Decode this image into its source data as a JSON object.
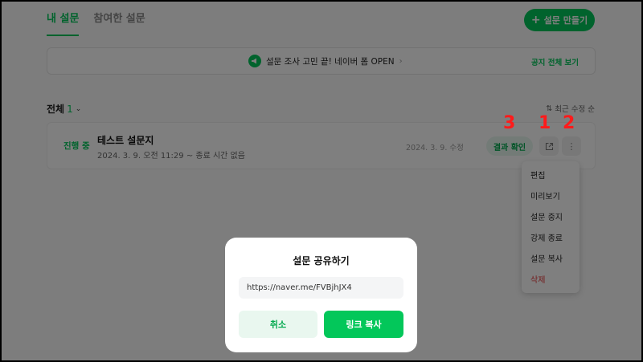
{
  "tabs": [
    {
      "label": "내 설문",
      "active": true
    },
    {
      "label": "참여한 설문",
      "active": false
    }
  ],
  "create_button": {
    "label": "설문 만들기",
    "icon": "plus-icon"
  },
  "notice": {
    "text": "설문 조사 고민 끝! 네이버 폼 OPEN",
    "view_all": "공지 전체 보기",
    "icon": "megaphone-icon"
  },
  "list": {
    "label": "전체",
    "count": "1",
    "sort_label": "최근 수정 순"
  },
  "survey": {
    "status": "진행 중",
    "title": "테스트 설문지",
    "date": "2024. 3. 9. 오전 11:29 ~ 종료 시간 없음",
    "modified": "2024. 3. 9. 수정",
    "result_button": "결과 확인"
  },
  "annotations": [
    "3",
    "1",
    "2"
  ],
  "menu": {
    "items": [
      "편집",
      "미리보기",
      "설문 중지",
      "강제 종료",
      "설문 복사",
      "삭제"
    ]
  },
  "modal": {
    "title": "설문 공유하기",
    "link": "https://naver.me/FVBjhJX4",
    "cancel": "취소",
    "copy": "링크 복사"
  },
  "colors": {
    "accent": "#03c75a",
    "danger": "#e5383b",
    "annotation": "#ff1a1a"
  }
}
